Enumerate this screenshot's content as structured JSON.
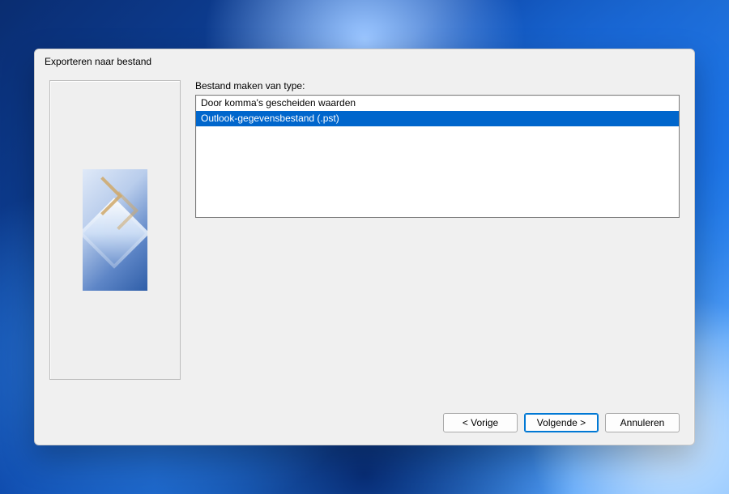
{
  "dialog": {
    "title": "Exporteren naar bestand",
    "field_label": "Bestand maken van type:",
    "options": [
      {
        "label": "Door komma's gescheiden waarden",
        "selected": false
      },
      {
        "label": "Outlook-gegevensbestand (.pst)",
        "selected": true
      }
    ],
    "buttons": {
      "back": "< Vorige",
      "next": "Volgende >",
      "cancel": "Annuleren"
    }
  }
}
